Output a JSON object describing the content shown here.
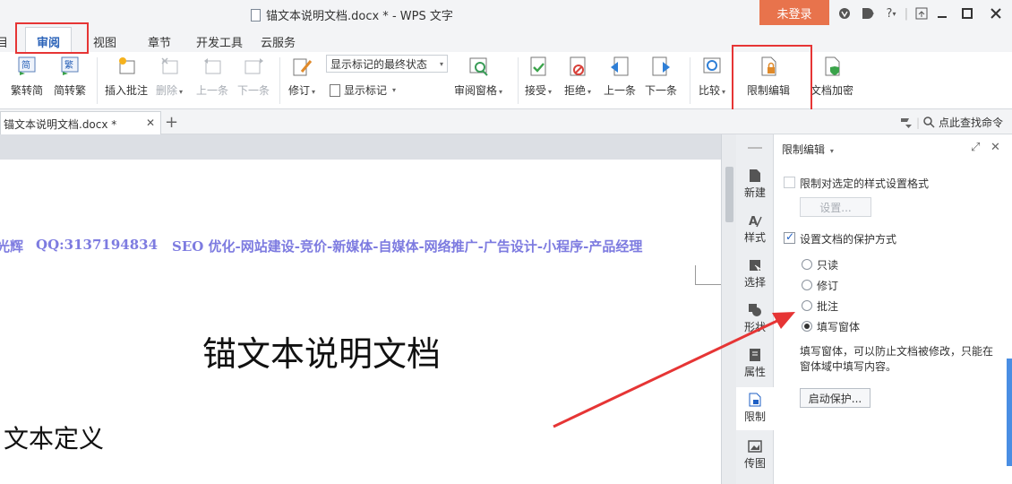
{
  "window": {
    "title": "锚文本说明文档.docx * - WPS 文字",
    "login_label": "未登录"
  },
  "menu": {
    "tabs": [
      "审阅",
      "视图",
      "章节",
      "开发工具",
      "云服务"
    ],
    "active": "审阅",
    "partial_left": "目"
  },
  "ribbon": {
    "trad_simp": "繁转简",
    "simp_trad": "简转繁",
    "insert_comment": "插入批注",
    "delete": "删除",
    "prev_comment": "上一条",
    "next_comment": "下一条",
    "track": "修订",
    "markup_state": "显示标记的最终状态",
    "show_markup": "显示标记",
    "review_pane": "审阅窗格",
    "accept": "接受",
    "reject": "拒绝",
    "prev_change": "上一条",
    "next_change": "下一条",
    "compare": "比较",
    "restrict_edit": "限制编辑",
    "encrypt": "文档加密"
  },
  "doctabs": {
    "current": "锚文本说明文档.docx *",
    "find_label": "点此查找命令"
  },
  "document": {
    "line_left": "光辉",
    "line_qq": "QQ:3137194834",
    "line_seo": "SEO 优化-网站建设-竞价-新媒体-自媒体-网络推广-广告设计-小程序-产品经理",
    "title": "锚文本说明文档",
    "heading": "文本定义"
  },
  "sidestrip": {
    "items": [
      "新建",
      "样式",
      "选择",
      "形状",
      "属性",
      "限制",
      "传图"
    ]
  },
  "pane": {
    "title": "限制编辑",
    "option1": "限制对选定的样式设置格式",
    "settings_btn": "设置...",
    "option2": "设置文档的保护方式",
    "radios": [
      "只读",
      "修订",
      "批注",
      "填写窗体"
    ],
    "selected": "填写窗体",
    "description": "填写窗体，可以防止文档被修改，只能在窗体域中填写内容。",
    "start_btn": "启动保护..."
  },
  "colors": {
    "login": "#e8734c",
    "annotation": "#e63535",
    "seo_text": "#7d7be0",
    "accent": "#2a62b8"
  }
}
